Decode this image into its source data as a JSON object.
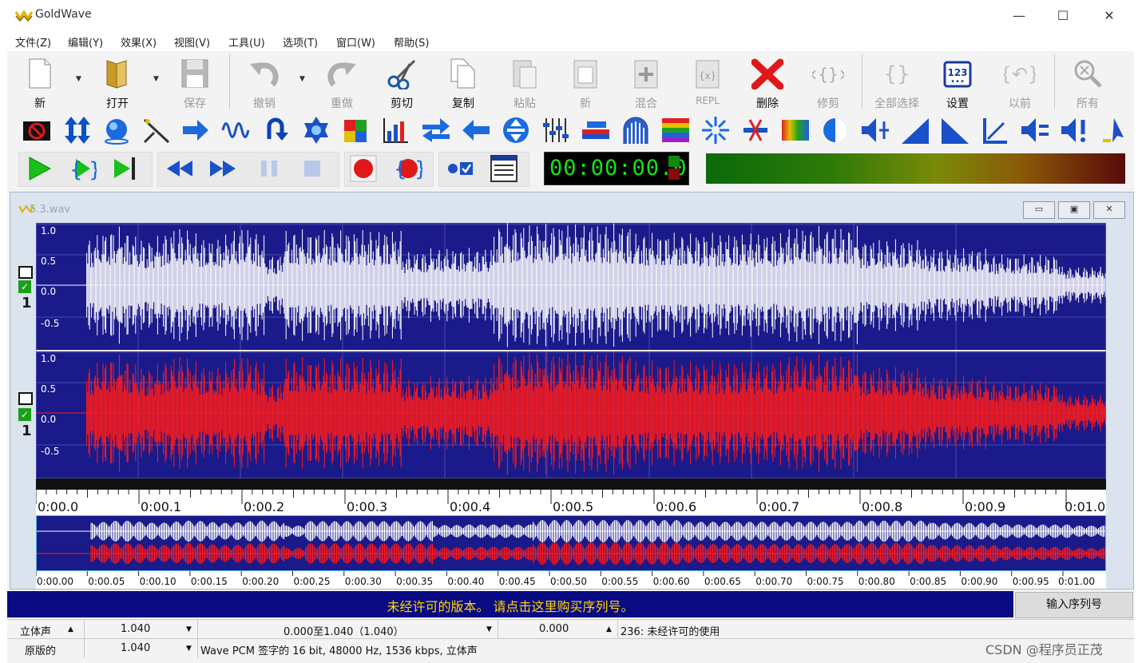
{
  "window": {
    "title": "GoldWave",
    "controls": [
      "—",
      "☐",
      "✕"
    ]
  },
  "menu": [
    "文件(Z)",
    "编辑(Y)",
    "效果(X)",
    "视图(V)",
    "工具(U)",
    "选项(T)",
    "窗口(W)",
    "帮助(S)"
  ],
  "toolbar1": [
    {
      "label": "新",
      "icon": "new-file-icon",
      "enabled": true
    },
    {
      "label": "打开",
      "icon": "open-folder-icon",
      "enabled": true
    },
    {
      "label": "保存",
      "icon": "save-disk-icon",
      "enabled": false
    },
    {
      "label": "撤销",
      "icon": "undo-icon",
      "enabled": false
    },
    {
      "label": "重做",
      "icon": "redo-icon",
      "enabled": false
    },
    {
      "label": "剪切",
      "icon": "scissors-icon",
      "enabled": true
    },
    {
      "label": "复制",
      "icon": "copy-icon",
      "enabled": true
    },
    {
      "label": "粘贴",
      "icon": "paste-icon",
      "enabled": false
    },
    {
      "label": "新",
      "icon": "paste-new-icon",
      "enabled": false
    },
    {
      "label": "混合",
      "icon": "mix-icon",
      "enabled": false
    },
    {
      "label": "REPL",
      "icon": "replace-icon",
      "enabled": false
    },
    {
      "label": "删除",
      "icon": "delete-x-icon",
      "enabled": true
    },
    {
      "label": "修剪",
      "icon": "trim-icon",
      "enabled": false
    },
    {
      "label": "全部选择",
      "icon": "select-all-icon",
      "enabled": false
    },
    {
      "label": "设置",
      "icon": "set-123-icon",
      "enabled": true
    },
    {
      "label": "以前",
      "icon": "previous-icon",
      "enabled": false
    },
    {
      "label": "所有",
      "icon": "zoom-all-icon",
      "enabled": false
    }
  ],
  "toolbar2_icons": [
    "stop-sign-icon",
    "vertical-arrows-icon",
    "sphere-icon",
    "cross-fade-icon",
    "arrow-right-in-icon",
    "wave-icon",
    "loop-back-icon",
    "gear-blue-icon",
    "colorful-cube-icon",
    "bar-chart-icon",
    "double-arrow-icon",
    "arrow-left-icon",
    "circle-vertical-icon",
    "equalizer-icon",
    "filter-bars-icon",
    "gate-icon",
    "rainbow-bars-icon",
    "spark-icon",
    "cross-out-icon",
    "spectrum-icon",
    "speaker-half-icon",
    "volume-split-icon",
    "ramp-up-icon",
    "ramp-down-icon",
    "marker-left-icon",
    "volume-equal-icon",
    "volume-bang-icon",
    "cursor-icon"
  ],
  "toolbar3_icons": [
    "play-icon",
    "play-selection-icon",
    "play-to-end-icon",
    "rewind-icon",
    "fast-forward-icon",
    "pause-icon",
    "stop-icon",
    "record-icon",
    "record-selection-icon",
    "monitor-icon",
    "control-panel-icon"
  ],
  "time_display": "00:00:00.0",
  "doc": {
    "title": "5.3.wav",
    "controls": [
      "▭",
      "▣",
      "✕"
    ],
    "y_labels": [
      "1.0",
      "0.5",
      "0.0",
      "-0.5"
    ],
    "channel_label": "1",
    "timeline": [
      "0:00.0",
      "0:00.1",
      "0:00.2",
      "0:00.3",
      "0:00.4",
      "0:00.5",
      "0:00.6",
      "0:00.7",
      "0:00.8",
      "0:00.9",
      "0:01.0"
    ],
    "overview_ticks": [
      "0:00.00",
      "0:00.05",
      "0:00.10",
      "0:00.15",
      "0:00.20",
      "0:00.25",
      "0:00.30",
      "0:00.35",
      "0:00.40",
      "0:00.45",
      "0:00.50",
      "0:00.55",
      "0:00.60",
      "0:00.65",
      "0:00.70",
      "0:00.75",
      "0:00.80",
      "0:00.85",
      "0:00.90",
      "0:00.95",
      "0:01.00"
    ],
    "left_color": "#ffffff",
    "right_color": "#ff1a1a",
    "bg_color": "#1a1a8a"
  },
  "nag": {
    "text": "未经许可的版本。 请点击这里购买序列号。",
    "button": "输入序列号"
  },
  "status": {
    "row1": {
      "channels": "立体声",
      "length": "1.040",
      "selection": "0.000至1.040（1.040）",
      "position": "0.000",
      "info": "236: 未经许可的使用"
    },
    "row2": {
      "label": "原版的",
      "length": "1.040",
      "format": "Wave PCM 签字的 16 bit, 48000 Hz, 1536 kbps, 立体声"
    }
  },
  "watermark": "CSDN @程序员正茂"
}
